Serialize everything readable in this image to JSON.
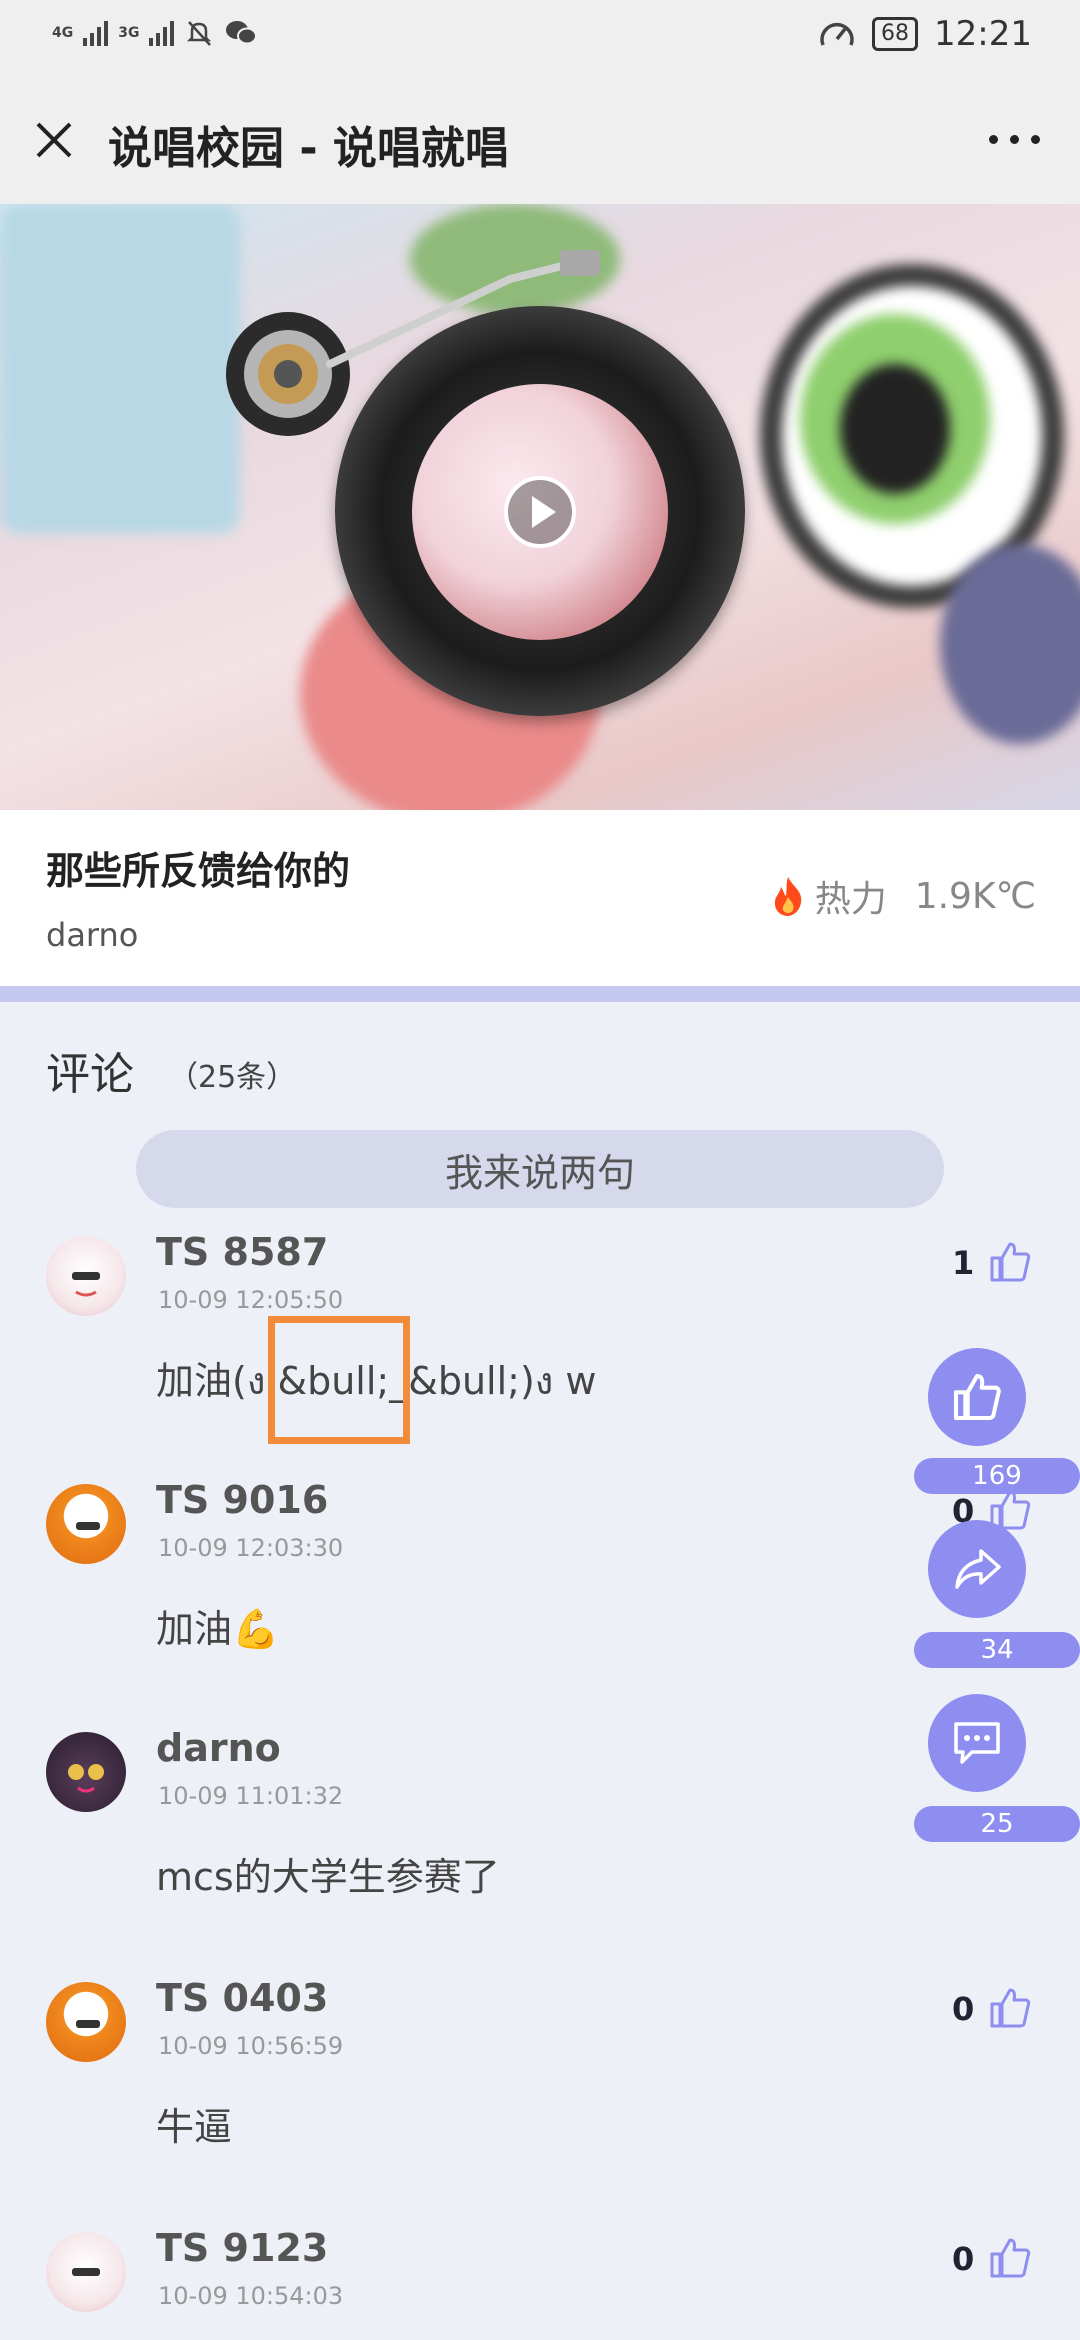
{
  "status_bar": {
    "net1": "4G",
    "net2": "3G",
    "battery": "68",
    "time": "12:21"
  },
  "header": {
    "title": "说唱校园 - 说唱就唱"
  },
  "song": {
    "title": "那些所反馈给你的",
    "artist": "darno",
    "heat_label": "热力",
    "heat_value": "1.9K℃"
  },
  "comments_section": {
    "title": "评论",
    "count": "（25条）",
    "input_placeholder": "我来说两句"
  },
  "comments": [
    {
      "user": "TS 8587",
      "time": "10-09 12:05:50",
      "text": "加油(ง &bull;_&bull;)ง w",
      "likes": "1"
    },
    {
      "user": "TS 9016",
      "time": "10-09 12:03:30",
      "text": "加油💪",
      "likes": "0"
    },
    {
      "user": "darno",
      "time": "10-09 11:01:32",
      "text": "mcs的大学生参赛了",
      "likes": ""
    },
    {
      "user": "TS 0403",
      "time": "10-09 10:56:59",
      "text": "牛逼",
      "likes": "0"
    },
    {
      "user": "TS 9123",
      "time": "10-09 10:54:03",
      "text": "",
      "likes": "0"
    }
  ],
  "floating": {
    "like_count": "169",
    "share_count": "34",
    "comment_count": "25"
  },
  "colors": {
    "accent": "#8d8ef0",
    "divider": "#c5c8ef",
    "highlight": "#f28c3a",
    "fire": "#ff4a1c"
  }
}
